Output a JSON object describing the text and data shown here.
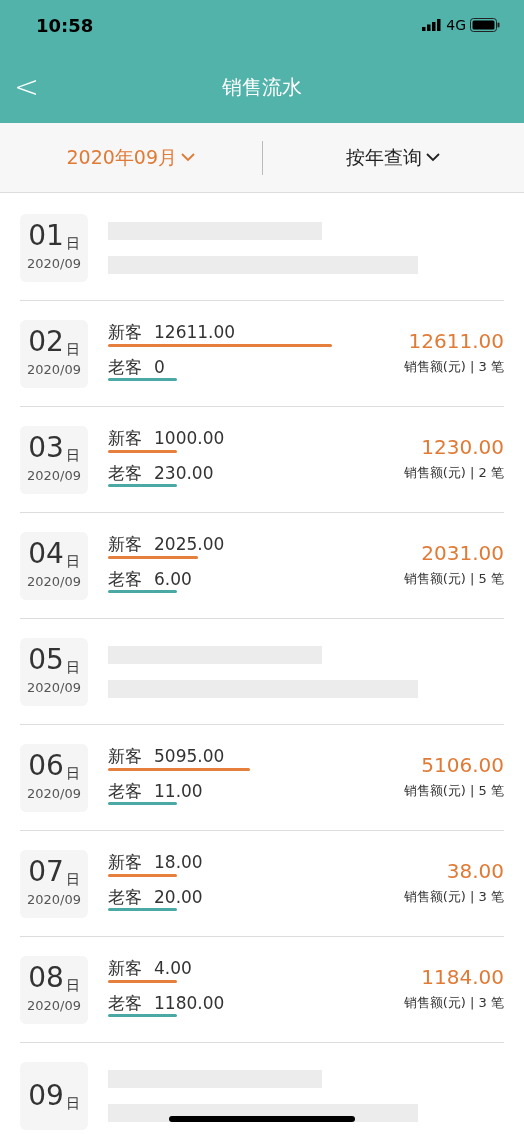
{
  "status_bar": {
    "time": "10:58",
    "network": "4G"
  },
  "nav": {
    "back": "<",
    "title": "销售流水"
  },
  "filters": [
    {
      "label": "2020年09月",
      "selected": true
    },
    {
      "label": "按年查询",
      "selected": false
    }
  ],
  "days": [
    {
      "kind": "empty",
      "day": "01",
      "unit": "日",
      "month": "2020/09"
    },
    {
      "kind": "sales",
      "day": "02",
      "unit": "日",
      "month": "2020/09",
      "new": {
        "label": "新客",
        "value": "12611.00"
      },
      "old": {
        "label": "老客",
        "value": "0"
      },
      "total": "12611.00",
      "summary": "销售额(元) | 3 笔"
    },
    {
      "kind": "sales",
      "day": "03",
      "unit": "日",
      "month": "2020/09",
      "new": {
        "label": "新客",
        "value": "1000.00"
      },
      "old": {
        "label": "老客",
        "value": "230.00"
      },
      "total": "1230.00",
      "summary": "销售额(元) | 2 笔"
    },
    {
      "kind": "sales",
      "day": "04",
      "unit": "日",
      "month": "2020/09",
      "new": {
        "label": "新客",
        "value": "2025.00"
      },
      "old": {
        "label": "老客",
        "value": "6.00"
      },
      "total": "2031.00",
      "summary": "销售额(元) | 5 笔"
    },
    {
      "kind": "empty",
      "day": "05",
      "unit": "日",
      "month": "2020/09"
    },
    {
      "kind": "sales",
      "day": "06",
      "unit": "日",
      "month": "2020/09",
      "new": {
        "label": "新客",
        "value": "5095.00"
      },
      "old": {
        "label": "老客",
        "value": "11.00"
      },
      "total": "5106.00",
      "summary": "销售额(元) | 5 笔"
    },
    {
      "kind": "sales",
      "day": "07",
      "unit": "日",
      "month": "2020/09",
      "new": {
        "label": "新客",
        "value": "18.00"
      },
      "old": {
        "label": "老客",
        "value": "20.00"
      },
      "total": "38.00",
      "summary": "销售额(元) | 3 笔"
    },
    {
      "kind": "sales",
      "day": "08",
      "unit": "日",
      "month": "2020/09",
      "new": {
        "label": "新客",
        "value": "4.00"
      },
      "old": {
        "label": "老客",
        "value": "1180.00"
      },
      "total": "1184.00",
      "summary": "销售额(元) | 3 笔"
    },
    {
      "kind": "empty",
      "day": "09",
      "unit": "日"
    }
  ]
}
